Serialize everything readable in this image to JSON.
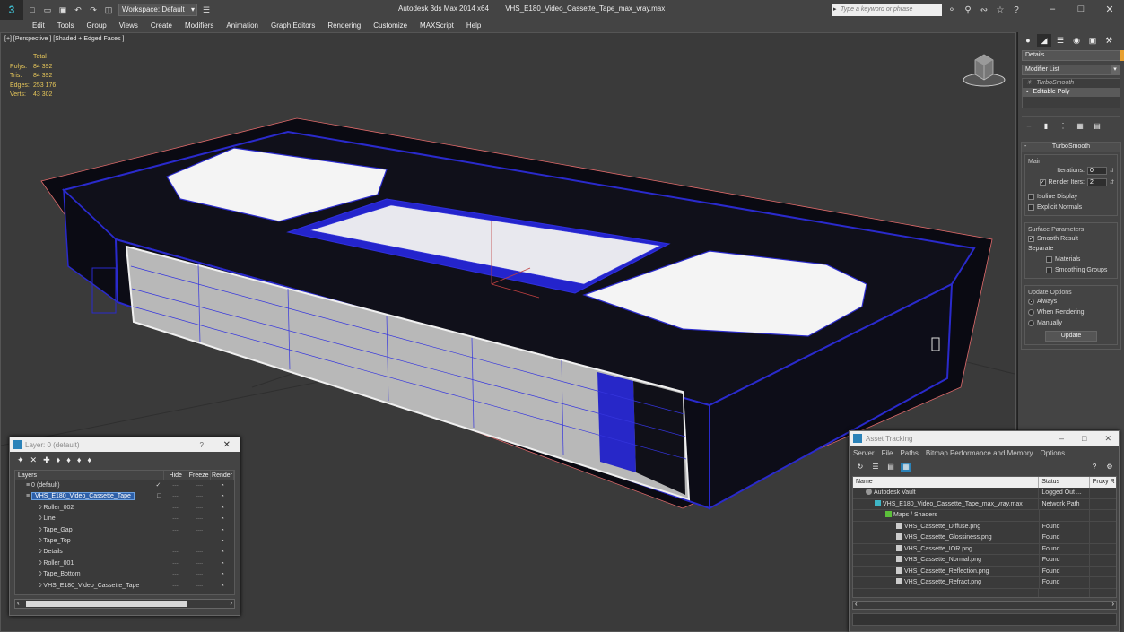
{
  "titlebar": {
    "app_logo": "3",
    "workspace_label": "Workspace: Default",
    "app_name": "Autodesk 3ds Max  2014 x64",
    "file_name": "VHS_E180_Video_Cassette_Tape_max_vray.max",
    "search_placeholder": "Type a keyword or phrase"
  },
  "menu": [
    "Edit",
    "Tools",
    "Group",
    "Views",
    "Create",
    "Modifiers",
    "Animation",
    "Graph Editors",
    "Rendering",
    "Customize",
    "MAXScript",
    "Help"
  ],
  "viewport": {
    "label": "[+] [Perspective ] [Shaded + Edged Faces ]",
    "stats_header": "Total",
    "stats": [
      {
        "key": "Polys:",
        "value": "84 392"
      },
      {
        "key": "Tris:",
        "value": "84 392"
      },
      {
        "key": "Edges:",
        "value": "253 176"
      },
      {
        "key": "Verts:",
        "value": "43 302"
      }
    ]
  },
  "command_panel": {
    "object_name": "Details",
    "object_color": "#e8a030",
    "modifier_list": "Modifier List",
    "stack": [
      "TurboSmooth",
      "Editable Poly"
    ],
    "rollout_title": "TurboSmooth",
    "main_group": "Main",
    "iterations_label": "Iterations:",
    "iterations_value": "0",
    "render_iters_label": "Render Iters:",
    "render_iters_value": "2",
    "isoline_label": "Isoline Display",
    "explicit_normals_label": "Explicit Normals",
    "surface_group": "Surface Parameters",
    "smooth_result_label": "Smooth Result",
    "separate_label": "Separate",
    "materials_label": "Materials",
    "smoothing_groups_label": "Smoothing Groups",
    "update_group": "Update Options",
    "always_label": "Always",
    "when_rendering_label": "When Rendering",
    "manually_label": "Manually",
    "update_button": "Update"
  },
  "layer_panel": {
    "title": "Layer: 0 (default)",
    "help": "?",
    "columns": {
      "layers": "Layers",
      "hide": "Hide",
      "freeze": "Freeze",
      "render": "Render"
    },
    "rows": [
      {
        "name": "0 (default)",
        "level": 0,
        "check": "✓"
      },
      {
        "name": "VHS_E180_Video_Cassette_Tape",
        "level": 0,
        "selected": true,
        "check": "□"
      },
      {
        "name": "Roller_002",
        "level": 1
      },
      {
        "name": "Line",
        "level": 1
      },
      {
        "name": "Tape_Gap",
        "level": 1
      },
      {
        "name": "Tape_Top",
        "level": 1
      },
      {
        "name": "Details",
        "level": 1
      },
      {
        "name": "Roller_001",
        "level": 1
      },
      {
        "name": "Tape_Bottom",
        "level": 1
      },
      {
        "name": "VHS_E180_Video_Cassette_Tape",
        "level": 1
      }
    ],
    "dash": "----",
    "render_icon": "◔"
  },
  "asset_panel": {
    "title": "Asset Tracking",
    "menu": [
      "Server",
      "File",
      "Paths",
      "Bitmap Performance and Memory",
      "Options"
    ],
    "columns": {
      "name": "Name",
      "status": "Status",
      "proxy": "Proxy R"
    },
    "rows": [
      {
        "name": "Autodesk Vault",
        "status": "Logged Out ...",
        "indent": 14,
        "icon": "vault"
      },
      {
        "name": "VHS_E180_Video_Cassette_Tape_max_vray.max",
        "status": "Network Path",
        "indent": 24,
        "icon": "max"
      },
      {
        "name": "Maps / Shaders",
        "status": "",
        "indent": 36,
        "icon": "maps"
      },
      {
        "name": "VHS_Cassette_Diffuse.png",
        "status": "Found",
        "indent": 48,
        "icon": "file"
      },
      {
        "name": "VHS_Cassette_Glossiness.png",
        "status": "Found",
        "indent": 48,
        "icon": "file"
      },
      {
        "name": "VHS_Cassette_IOR.png",
        "status": "Found",
        "indent": 48,
        "icon": "file"
      },
      {
        "name": "VHS_Cassette_Normal.png",
        "status": "Found",
        "indent": 48,
        "icon": "file"
      },
      {
        "name": "VHS_Cassette_Reflection.png",
        "status": "Found",
        "indent": 48,
        "icon": "file"
      },
      {
        "name": "VHS_Cassette_Refract.png",
        "status": "Found",
        "indent": 48,
        "icon": "file"
      }
    ]
  }
}
